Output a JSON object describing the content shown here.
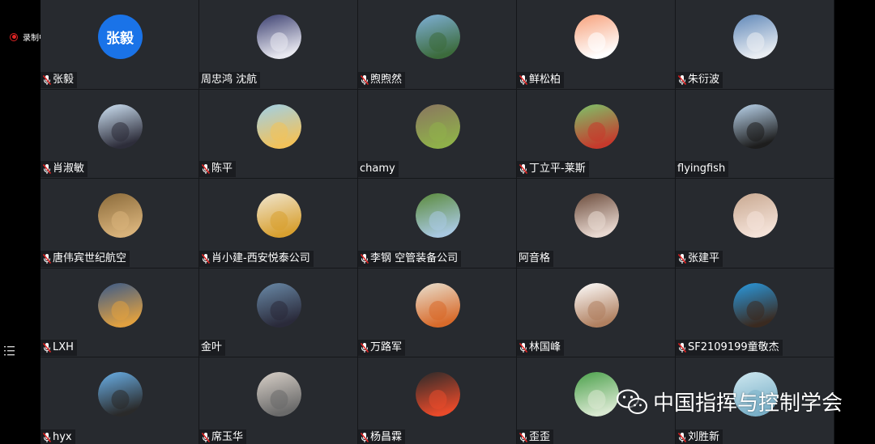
{
  "recording": {
    "label": "录制中",
    "color": "#e02424"
  },
  "watermark": {
    "text": "中国指挥与控制学会",
    "icon": "wechat-icon"
  },
  "participants": [
    {
      "name": "张毅",
      "muted": true,
      "avatar": {
        "type": "initials",
        "text": "张毅",
        "bg": "#1a73e8"
      }
    },
    {
      "name": "周忠鸿 沈航",
      "muted": false,
      "avatar": {
        "type": "image",
        "c1": "#3b3f70",
        "c2": "#e8e8f0"
      }
    },
    {
      "name": "煦煦然",
      "muted": true,
      "avatar": {
        "type": "image",
        "c1": "#7fb0d8",
        "c2": "#3c6b3c"
      }
    },
    {
      "name": "鲜松柏",
      "muted": true,
      "avatar": {
        "type": "image",
        "c1": "#f7a07a",
        "c2": "#ffffff"
      }
    },
    {
      "name": "朱衍波",
      "muted": true,
      "avatar": {
        "type": "image",
        "c1": "#5f87b8",
        "c2": "#e9edf2"
      }
    },
    {
      "name": "肖淑敏",
      "muted": true,
      "avatar": {
        "type": "image",
        "c1": "#cfe3f5",
        "c2": "#2d2d3a"
      }
    },
    {
      "name": "陈平",
      "muted": true,
      "avatar": {
        "type": "image",
        "c1": "#9fd0e8",
        "c2": "#f2c25a"
      }
    },
    {
      "name": "chamy",
      "muted": false,
      "avatar": {
        "type": "image",
        "c1": "#8a7560",
        "c2": "#8fb04a"
      }
    },
    {
      "name": "丁立平-莱斯",
      "muted": true,
      "avatar": {
        "type": "image",
        "c1": "#7cc46a",
        "c2": "#c63a2c"
      }
    },
    {
      "name": "flyingfish",
      "muted": false,
      "avatar": {
        "type": "image",
        "c1": "#bcd6ee",
        "c2": "#1d1d1d"
      }
    },
    {
      "name": "唐伟宾世纪航空",
      "muted": true,
      "avatar": {
        "type": "image",
        "c1": "#8a6a3a",
        "c2": "#d8b27a"
      }
    },
    {
      "name": "肖小建-西安悦泰公司",
      "muted": true,
      "avatar": {
        "type": "image",
        "c1": "#f0e6d0",
        "c2": "#d8a030"
      }
    },
    {
      "name": "李钢 空管装备公司",
      "muted": true,
      "avatar": {
        "type": "image",
        "c1": "#5a8a3a",
        "c2": "#a8c8e0"
      }
    },
    {
      "name": "阿音格",
      "muted": false,
      "avatar": {
        "type": "image",
        "c1": "#6a4a3a",
        "c2": "#e8d8d0"
      }
    },
    {
      "name": "张建平",
      "muted": true,
      "avatar": {
        "type": "image",
        "c1": "#c8a890",
        "c2": "#f4e2d8"
      }
    },
    {
      "name": "LXH",
      "muted": true,
      "avatar": {
        "type": "image",
        "c1": "#3a5a8a",
        "c2": "#e0a040"
      }
    },
    {
      "name": "金叶",
      "muted": false,
      "avatar": {
        "type": "image",
        "c1": "#6a8aa8",
        "c2": "#2a2a3a"
      }
    },
    {
      "name": "万路军",
      "muted": true,
      "avatar": {
        "type": "image",
        "c1": "#e8e0d0",
        "c2": "#d86a2a"
      }
    },
    {
      "name": "林国峰",
      "muted": true,
      "avatar": {
        "type": "image",
        "c1": "#ffffff",
        "c2": "#b08060"
      }
    },
    {
      "name": "SF2109199童敬杰",
      "muted": true,
      "avatar": {
        "type": "image",
        "c1": "#2a9ae0",
        "c2": "#3a2a20"
      }
    },
    {
      "name": "hyx",
      "muted": true,
      "avatar": {
        "type": "image",
        "c1": "#6ab0e8",
        "c2": "#2a2a2a"
      }
    },
    {
      "name": "席玉华",
      "muted": true,
      "avatar": {
        "type": "image",
        "c1": "#d8d0c8",
        "c2": "#6a6a6a"
      }
    },
    {
      "name": "杨昌霖",
      "muted": true,
      "avatar": {
        "type": "image",
        "c1": "#2a2a2a",
        "c2": "#e84a2a"
      }
    },
    {
      "name": "歪歪",
      "muted": true,
      "avatar": {
        "type": "image",
        "c1": "#4aa04a",
        "c2": "#d8e8d0"
      }
    },
    {
      "name": "刘胜新",
      "muted": true,
      "avatar": {
        "type": "image",
        "c1": "#cfe8f0",
        "c2": "#7ab0c8"
      }
    }
  ]
}
